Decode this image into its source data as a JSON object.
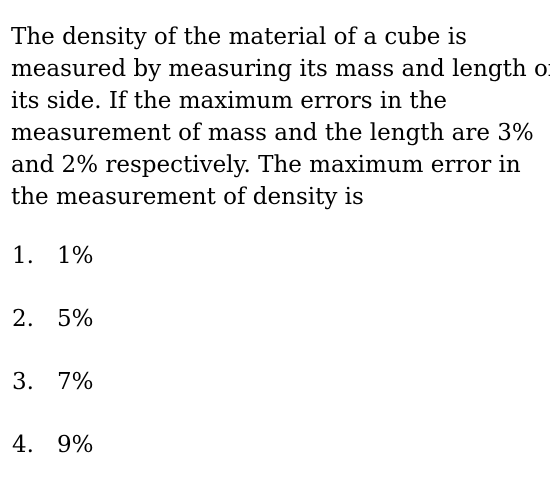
{
  "question": {
    "lines": [
      "The density of the material of a cube is",
      "measured by measuring its mass and length of",
      "its side. If the maximum errors in the",
      "measurement of mass and the length are 3%",
      "and 2% respectively. The maximum error in",
      "the measurement of density is"
    ]
  },
  "options": [
    {
      "number": "1.",
      "text": "1%"
    },
    {
      "number": "2.",
      "text": "5%"
    },
    {
      "number": "3.",
      "text": "7%"
    },
    {
      "number": "4.",
      "text": "9%"
    }
  ]
}
